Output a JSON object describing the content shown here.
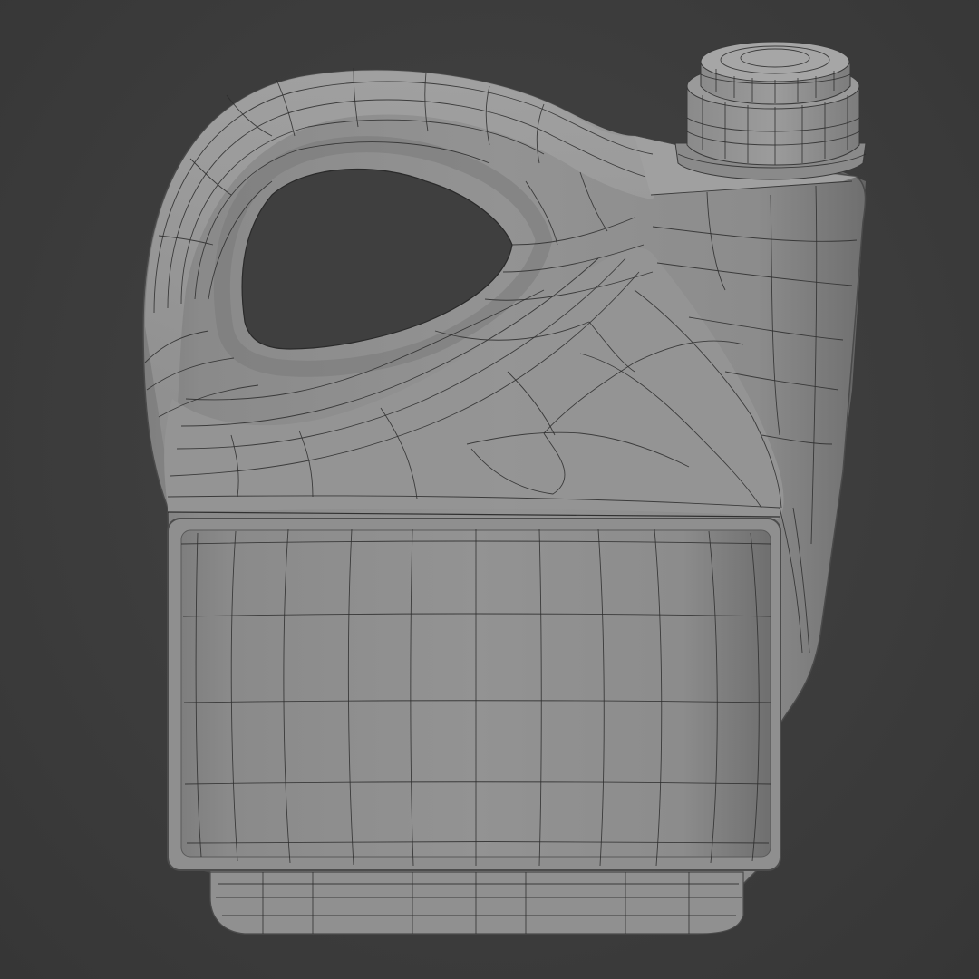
{
  "scene": {
    "subject": "jerrycan-wireframe-model",
    "colors": {
      "background": "#3d3d3d",
      "surface_light": "#9a9a9a",
      "surface_mid": "#858585",
      "surface_dark": "#6a6a6a",
      "wire": "#2b2b2b"
    }
  }
}
